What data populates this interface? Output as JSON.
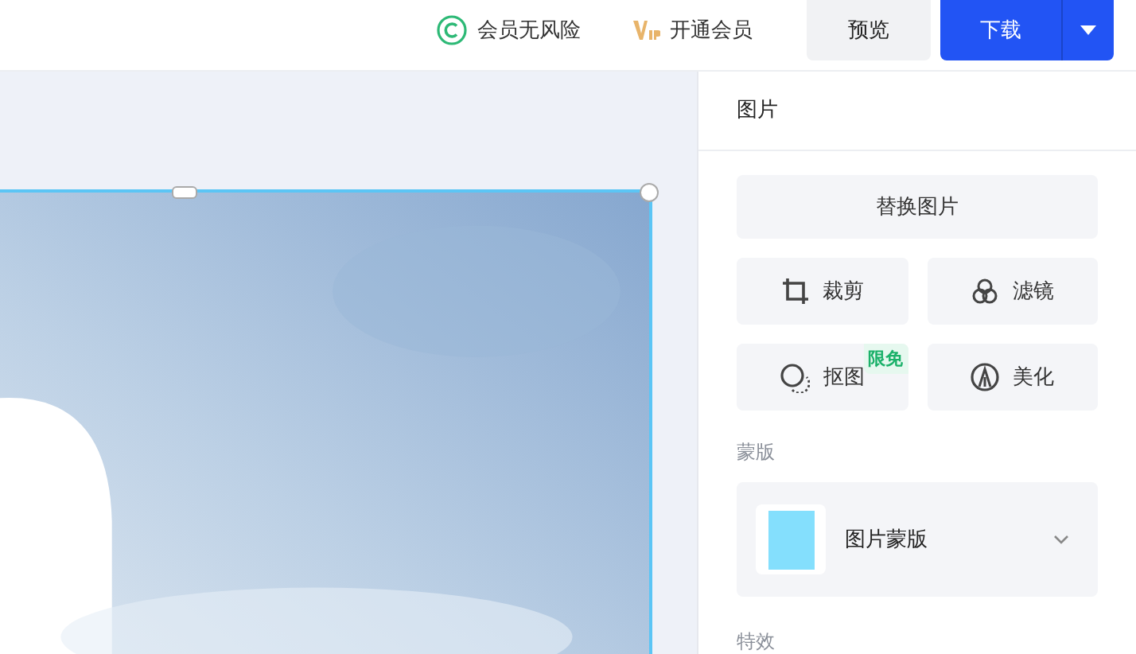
{
  "toolbar": {
    "items": [
      {
        "kind": "copyright",
        "label": "会员无风险"
      },
      {
        "kind": "vip",
        "label": "开通会员"
      }
    ],
    "preview_button": "预览",
    "download_button": "下载"
  },
  "canvas": {
    "image": {
      "kind": "picture",
      "selected": true
    }
  },
  "panel": {
    "title": "图片",
    "replace_button": "替换图片",
    "tools": [
      {
        "kind": "crop",
        "label": "裁剪"
      },
      {
        "kind": "filter",
        "label": "滤镜"
      },
      {
        "kind": "cutout",
        "label": "抠图",
        "badge": "限免"
      },
      {
        "kind": "beautify",
        "label": "美化"
      }
    ],
    "mask_section": {
      "title": "蒙版",
      "value": "图片蒙版"
    },
    "effects_section": {
      "title": "特效"
    }
  }
}
